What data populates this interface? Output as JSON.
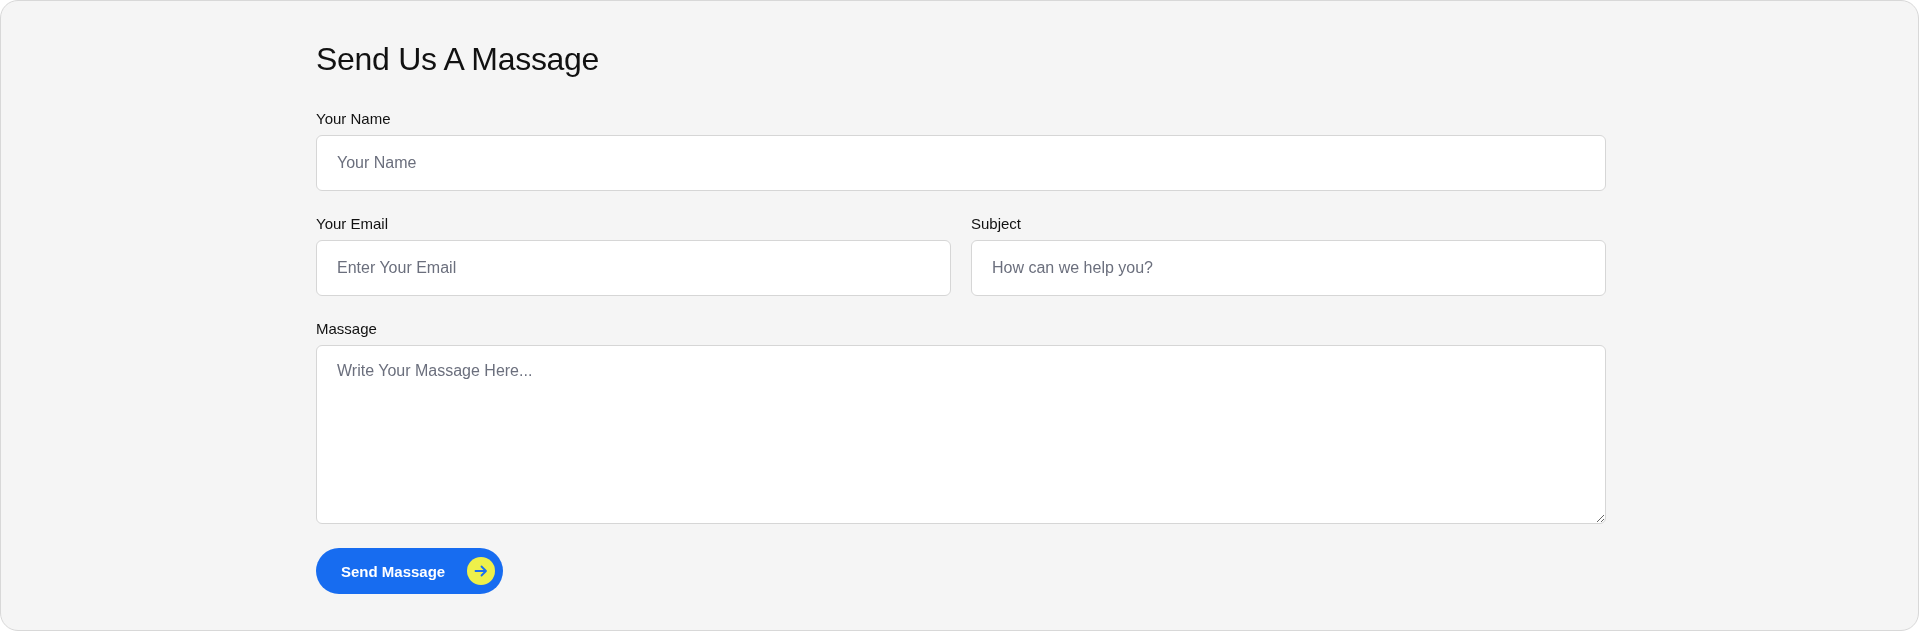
{
  "title": "Send Us A Massage",
  "rows": [
    [
      {
        "kind": "input",
        "label": "Your Name",
        "placeholder": "Your Name"
      }
    ],
    [
      {
        "kind": "input",
        "label": "Your Email",
        "placeholder": "Enter Your Email"
      },
      {
        "kind": "input",
        "label": "Subject",
        "placeholder": "How can we help you?"
      }
    ],
    [
      {
        "kind": "textarea",
        "label": "Massage",
        "placeholder": "Write Your Massage Here..."
      }
    ]
  ],
  "submit": {
    "label": "Send Massage"
  }
}
